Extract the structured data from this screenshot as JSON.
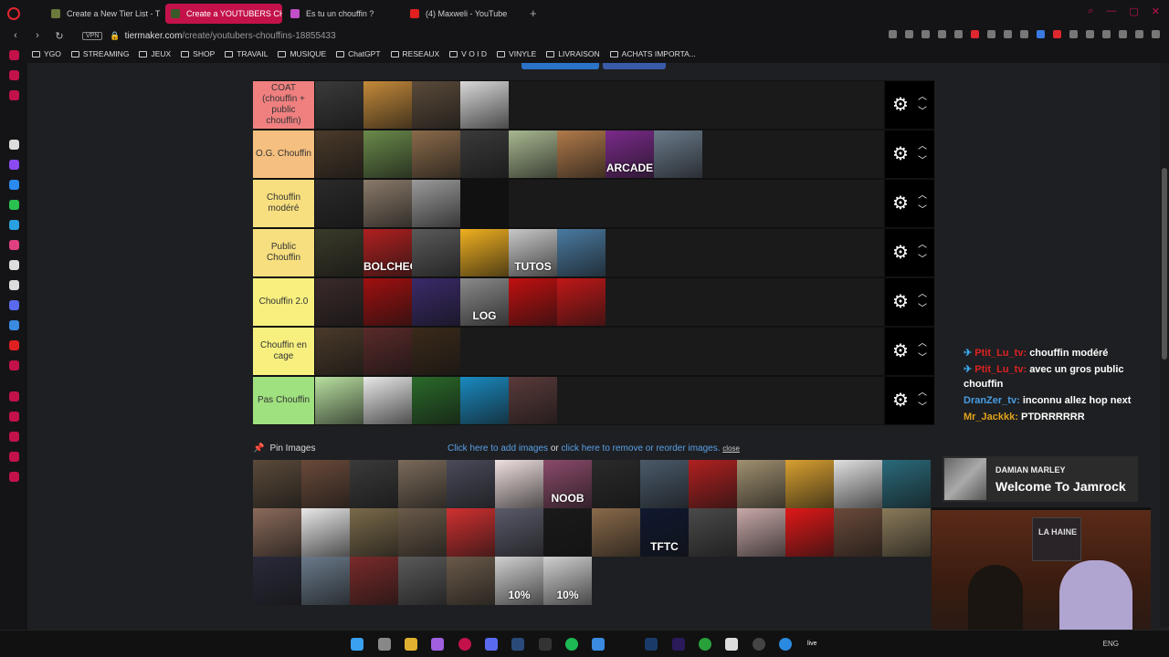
{
  "browser": {
    "tabs": [
      {
        "label": "Create a New Tier List - T",
        "icon_color": "#6b7a3a",
        "active": false
      },
      {
        "label": "Create a YOUTUBERS CH",
        "icon_color": "#3b5a2a",
        "active": true
      },
      {
        "label": "Es tu un chouffin ?",
        "icon_color": "#c14fc8",
        "active": false
      },
      {
        "label": "(4) Maxweli - YouTube",
        "icon_color": "#e02020",
        "active": false
      }
    ],
    "new_tab": "+",
    "vpn": "VPN",
    "url_host": "tiermaker.com",
    "url_path": "/create/youtubers-chouffins-18855433",
    "bookmarks": [
      "YGO",
      "STREAMING",
      "JEUX",
      "SHOP",
      "TRAVAIL",
      "MUSIQUE",
      "ChatGPT",
      "RESEAUX",
      "V O I D",
      "VINYLE",
      "LIVRAISON",
      "ACHATS IMPORTA..."
    ]
  },
  "tiers": [
    {
      "label": "COAT (chouffin + public chouffin)",
      "color": "#f08080",
      "thumbs": [
        "#3a3a3a",
        "#c48a3a",
        "#5a4a3a",
        "#d8d8d8"
      ]
    },
    {
      "label": "O.G. Chouffin",
      "color": "#f5bf7f",
      "thumbs": [
        "#4a3a2a",
        "#6a8a4a",
        "#8a6a4a",
        "#3a3a3a",
        "#a8b890",
        "#b07a4a",
        "#7a2a8a",
        "#6a7a8a"
      ]
    },
    {
      "label": "Chouffin modéré",
      "color": "#f7df7f",
      "thumbs": [
        "#2a2a2a",
        "#8a7a6a",
        "#9a9a9a",
        "#111111"
      ]
    },
    {
      "label": "Public Chouffin",
      "color": "#f7df7f",
      "thumbs": [
        "#3a3a2a",
        "#b02020",
        "#5a5a5a",
        "#f0b020",
        "#c8c8c8",
        "#4a7aa0"
      ]
    },
    {
      "label": "Chouffin 2.0",
      "color": "#f7f07f",
      "thumbs": [
        "#3a2a2a",
        "#a01010",
        "#3a2a6a",
        "#8a8a8a",
        "#c01010",
        "#c01818"
      ]
    },
    {
      "label": "Chouffin en cage",
      "color": "#f7f07f",
      "thumbs": [
        "#4a3a2a",
        "#5a2a2a",
        "#3a2a1a"
      ]
    },
    {
      "label": "Pas Chouffin",
      "color": "#9fe07f",
      "thumbs": [
        "#b8e0a0",
        "#e8e8e8",
        "#2a6a2a",
        "#1a8ac0",
        "#5a3a3a"
      ]
    }
  ],
  "tier_thumb_text": {
    "O.G. Chouffin": {
      "6": "ARCADE"
    },
    "Public Chouffin": {
      "1": "BOLCHEGEEK",
      "4": "TUTOS"
    },
    "Chouffin 2.0": {
      "3": "LOG"
    }
  },
  "pin": {
    "label": "Pin Images",
    "add_link": "Click here to add images",
    "or": "or",
    "remove_link": "click here to remove or reorder images.",
    "close": "close"
  },
  "pool": [
    {
      "c": "#5a4a3a"
    },
    {
      "c": "#6a4a3a"
    },
    {
      "c": "#3a3a3a"
    },
    {
      "c": "#7a6a5a"
    },
    {
      "c": "#4a4a5a"
    },
    {
      "c": "#f0e0e0"
    },
    {
      "c": "#8a4a6a",
      "t": "NOOB"
    },
    {
      "c": "#2a2a2a"
    },
    {
      "c": "#4a5a6a"
    },
    {
      "c": "#b02020"
    },
    {
      "c": "#a09070"
    },
    {
      "c": "#d8a030"
    },
    {
      "c": "#e0e0e0"
    },
    {
      "c": "#2a6a7a"
    },
    {
      "c": "#8a6a5a"
    },
    {
      "c": "#e8e8e8"
    },
    {
      "c": "#7a6a4a"
    },
    {
      "c": "#6a5a4a"
    },
    {
      "c": "#d03030"
    },
    {
      "c": "#5a5a6a"
    },
    {
      "c": "#1a1a1a"
    },
    {
      "c": "#8a6a4a"
    },
    {
      "c": "#101830",
      "t": "TFTC"
    },
    {
      "c": "#4a4a4a"
    },
    {
      "c": "#c8a8a8"
    },
    {
      "c": "#e01818"
    },
    {
      "c": "#6a4a3a"
    },
    {
      "c": "#8a7a5a"
    },
    {
      "c": "#2a2a3a"
    },
    {
      "c": "#6a7a8a"
    },
    {
      "c": "#7a2a2a"
    },
    {
      "c": "#5a5a5a"
    },
    {
      "c": "#6a5a4a"
    },
    {
      "c": "#d0d0d0",
      "t": "10%"
    },
    {
      "c": "#d0d0d0",
      "t": "10%"
    }
  ],
  "chat": [
    {
      "user": "Ptit_Lu_tv:",
      "text": "chouffin modéré",
      "cls": "u1",
      "pinned": true
    },
    {
      "user": "Ptit_Lu_tv:",
      "text": "avec un gros public chouffin",
      "cls": "u1",
      "pinned": true
    },
    {
      "user": "DranZer_tv:",
      "text": "inconnu allez hop next",
      "cls": "u2",
      "pinned": false
    },
    {
      "user": "Mr_Jackkk:",
      "text": "PTDRRRRRR",
      "cls": "u3",
      "pinned": false
    }
  ],
  "now_playing": {
    "artist": "DAMIAN MARLEY",
    "song": "Welcome To Jamrock"
  },
  "webcam": {
    "poster_text": "LA HAINE"
  },
  "taskbar": {
    "lang": "ENG",
    "live": "live"
  }
}
